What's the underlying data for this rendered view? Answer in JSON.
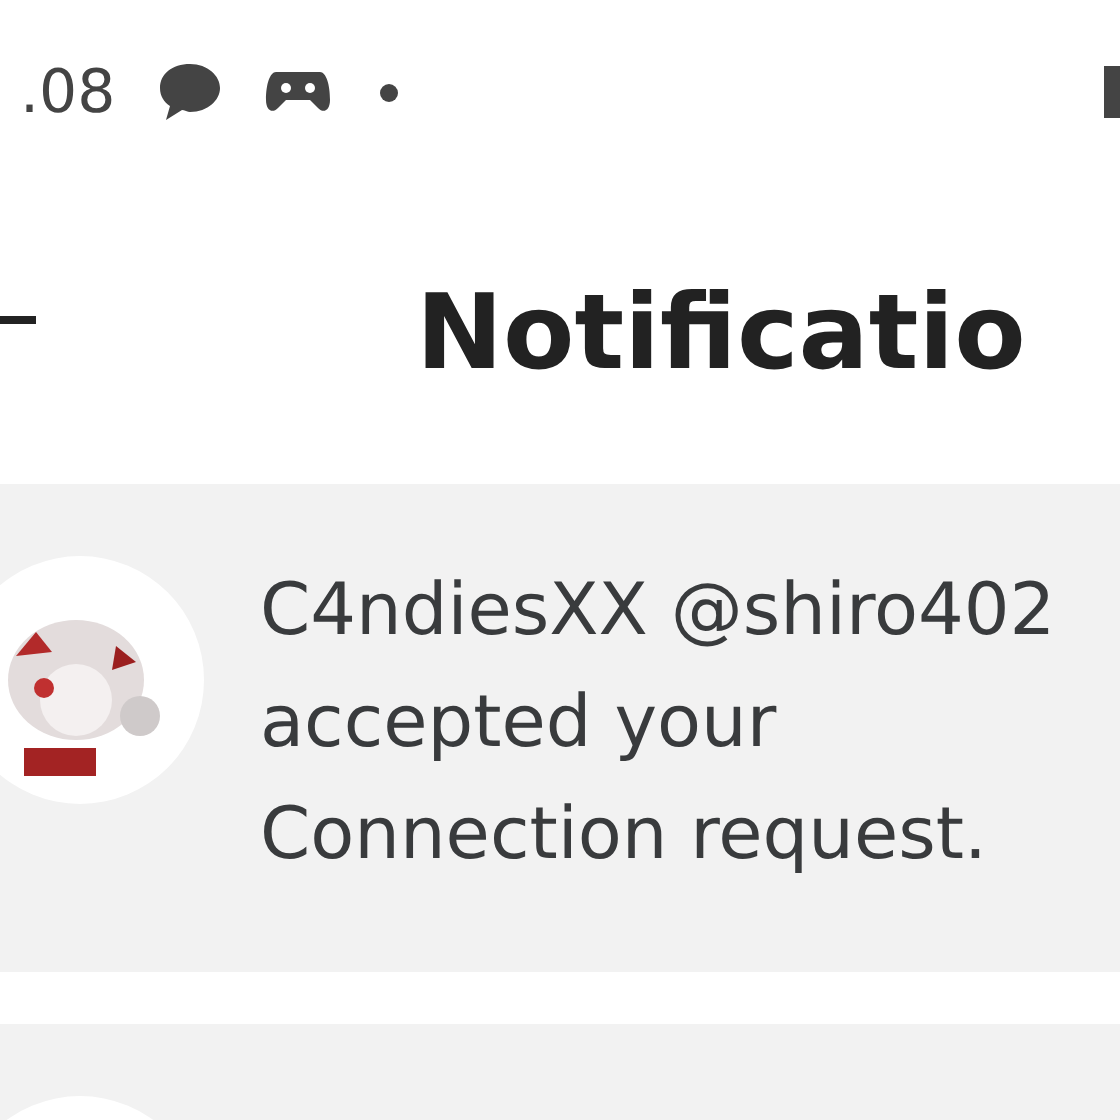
{
  "status_bar": {
    "time": ".08"
  },
  "header": {
    "title": "Notificatio"
  },
  "notifications": [
    {
      "kind": "message",
      "lines": [
        "C4ndiesXX @shiro402",
        "accepted your",
        "Connection request."
      ]
    },
    {
      "kind": "partial"
    }
  ]
}
